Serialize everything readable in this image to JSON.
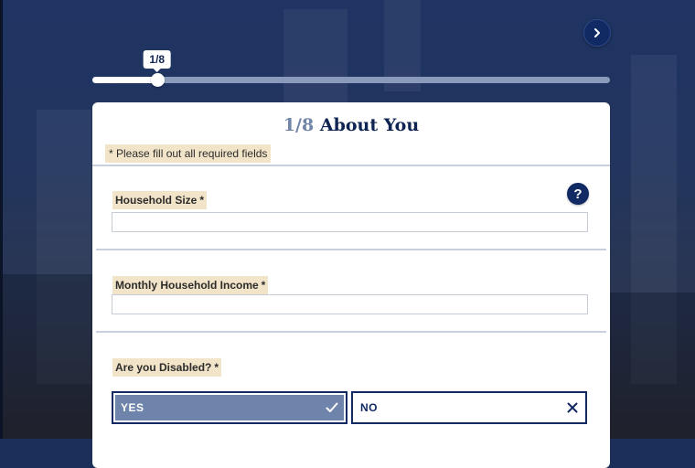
{
  "progress": {
    "label": "1/8",
    "fraction": 0.125
  },
  "card": {
    "step": "1/8",
    "title": "About You",
    "required_note": "* Please fill out all required fields",
    "help_label": "?"
  },
  "fields": [
    {
      "label": "Household Size",
      "required_mark": "*",
      "value": ""
    },
    {
      "label": "Monthly Household Income",
      "required_mark": "*",
      "value": ""
    }
  ],
  "disabled_question": {
    "label": "Are you Disabled?",
    "required_mark": "*",
    "options": [
      {
        "label": "YES",
        "selected": true,
        "icon": "checkmark-icon"
      },
      {
        "label": "NO",
        "selected": false,
        "icon": "close-icon"
      }
    ]
  },
  "icons": {
    "next": "chevron-right-icon",
    "help": "question-icon"
  },
  "colors": {
    "primary": "#112a63",
    "selected_option": "#6f84ab",
    "label_highlight": "#f2e4c8",
    "step_text": "#7085a8"
  }
}
